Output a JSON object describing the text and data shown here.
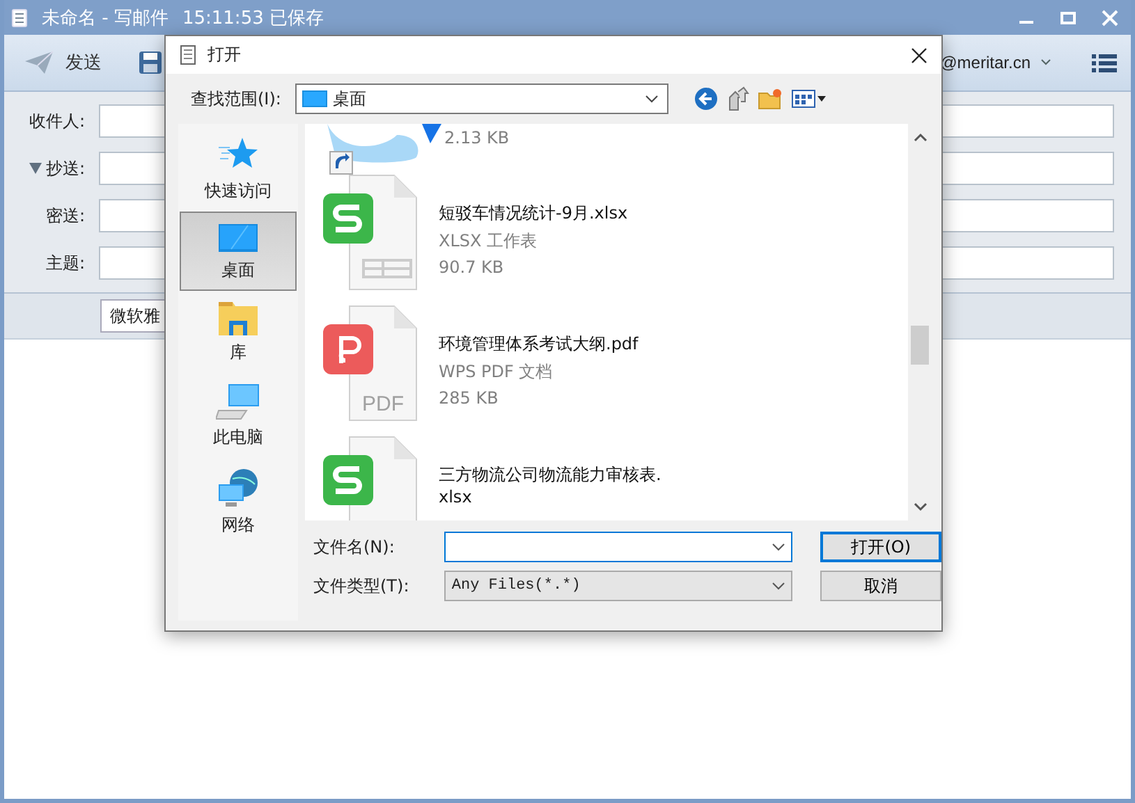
{
  "window": {
    "title": "未命名 - 写邮件",
    "saved": "15:11:53 已保存"
  },
  "toolbar": {
    "send": "发送",
    "account": "@meritar.cn"
  },
  "fields": [
    {
      "label": "收件人:",
      "collapsible": false
    },
    {
      "label": "抄送:",
      "collapsible": true
    },
    {
      "label": "密送:",
      "collapsible": false
    },
    {
      "label": "主题:",
      "collapsible": false
    }
  ],
  "font_select": "微软雅",
  "dialog": {
    "title": "打开",
    "look_in_label": "查找范围(I):",
    "look_in": "桌面",
    "places": [
      {
        "kind": "star",
        "label": "快速访问",
        "selected": false
      },
      {
        "kind": "desktop",
        "label": "桌面",
        "selected": true
      },
      {
        "kind": "library",
        "label": "库",
        "selected": false
      },
      {
        "kind": "computer",
        "label": "此电脑",
        "selected": false
      },
      {
        "kind": "network",
        "label": "网络",
        "selected": false
      }
    ],
    "files": [
      {
        "kind": "shortcut",
        "details": [
          "2.13 KB"
        ]
      },
      {
        "kind": "sheet",
        "name": "短驳车情况统计-9月.xlsx",
        "details": [
          "XLSX 工作表",
          "90.7 KB"
        ]
      },
      {
        "kind": "pdf",
        "icon_label": "PDF",
        "name": "环境管理体系考试大纲.pdf",
        "details": [
          "WPS PDF 文档",
          "285 KB"
        ]
      },
      {
        "kind": "sheet",
        "name": "三方物流公司物流能力审核表.xlsx"
      }
    ],
    "file_name_label": "文件名(N):",
    "file_type_label": "文件类型(T):",
    "file_type": "Any Files(*.*)",
    "buttons": [
      {
        "label": "打开(O)",
        "default": true
      },
      {
        "label": "取消",
        "default": false
      }
    ]
  }
}
